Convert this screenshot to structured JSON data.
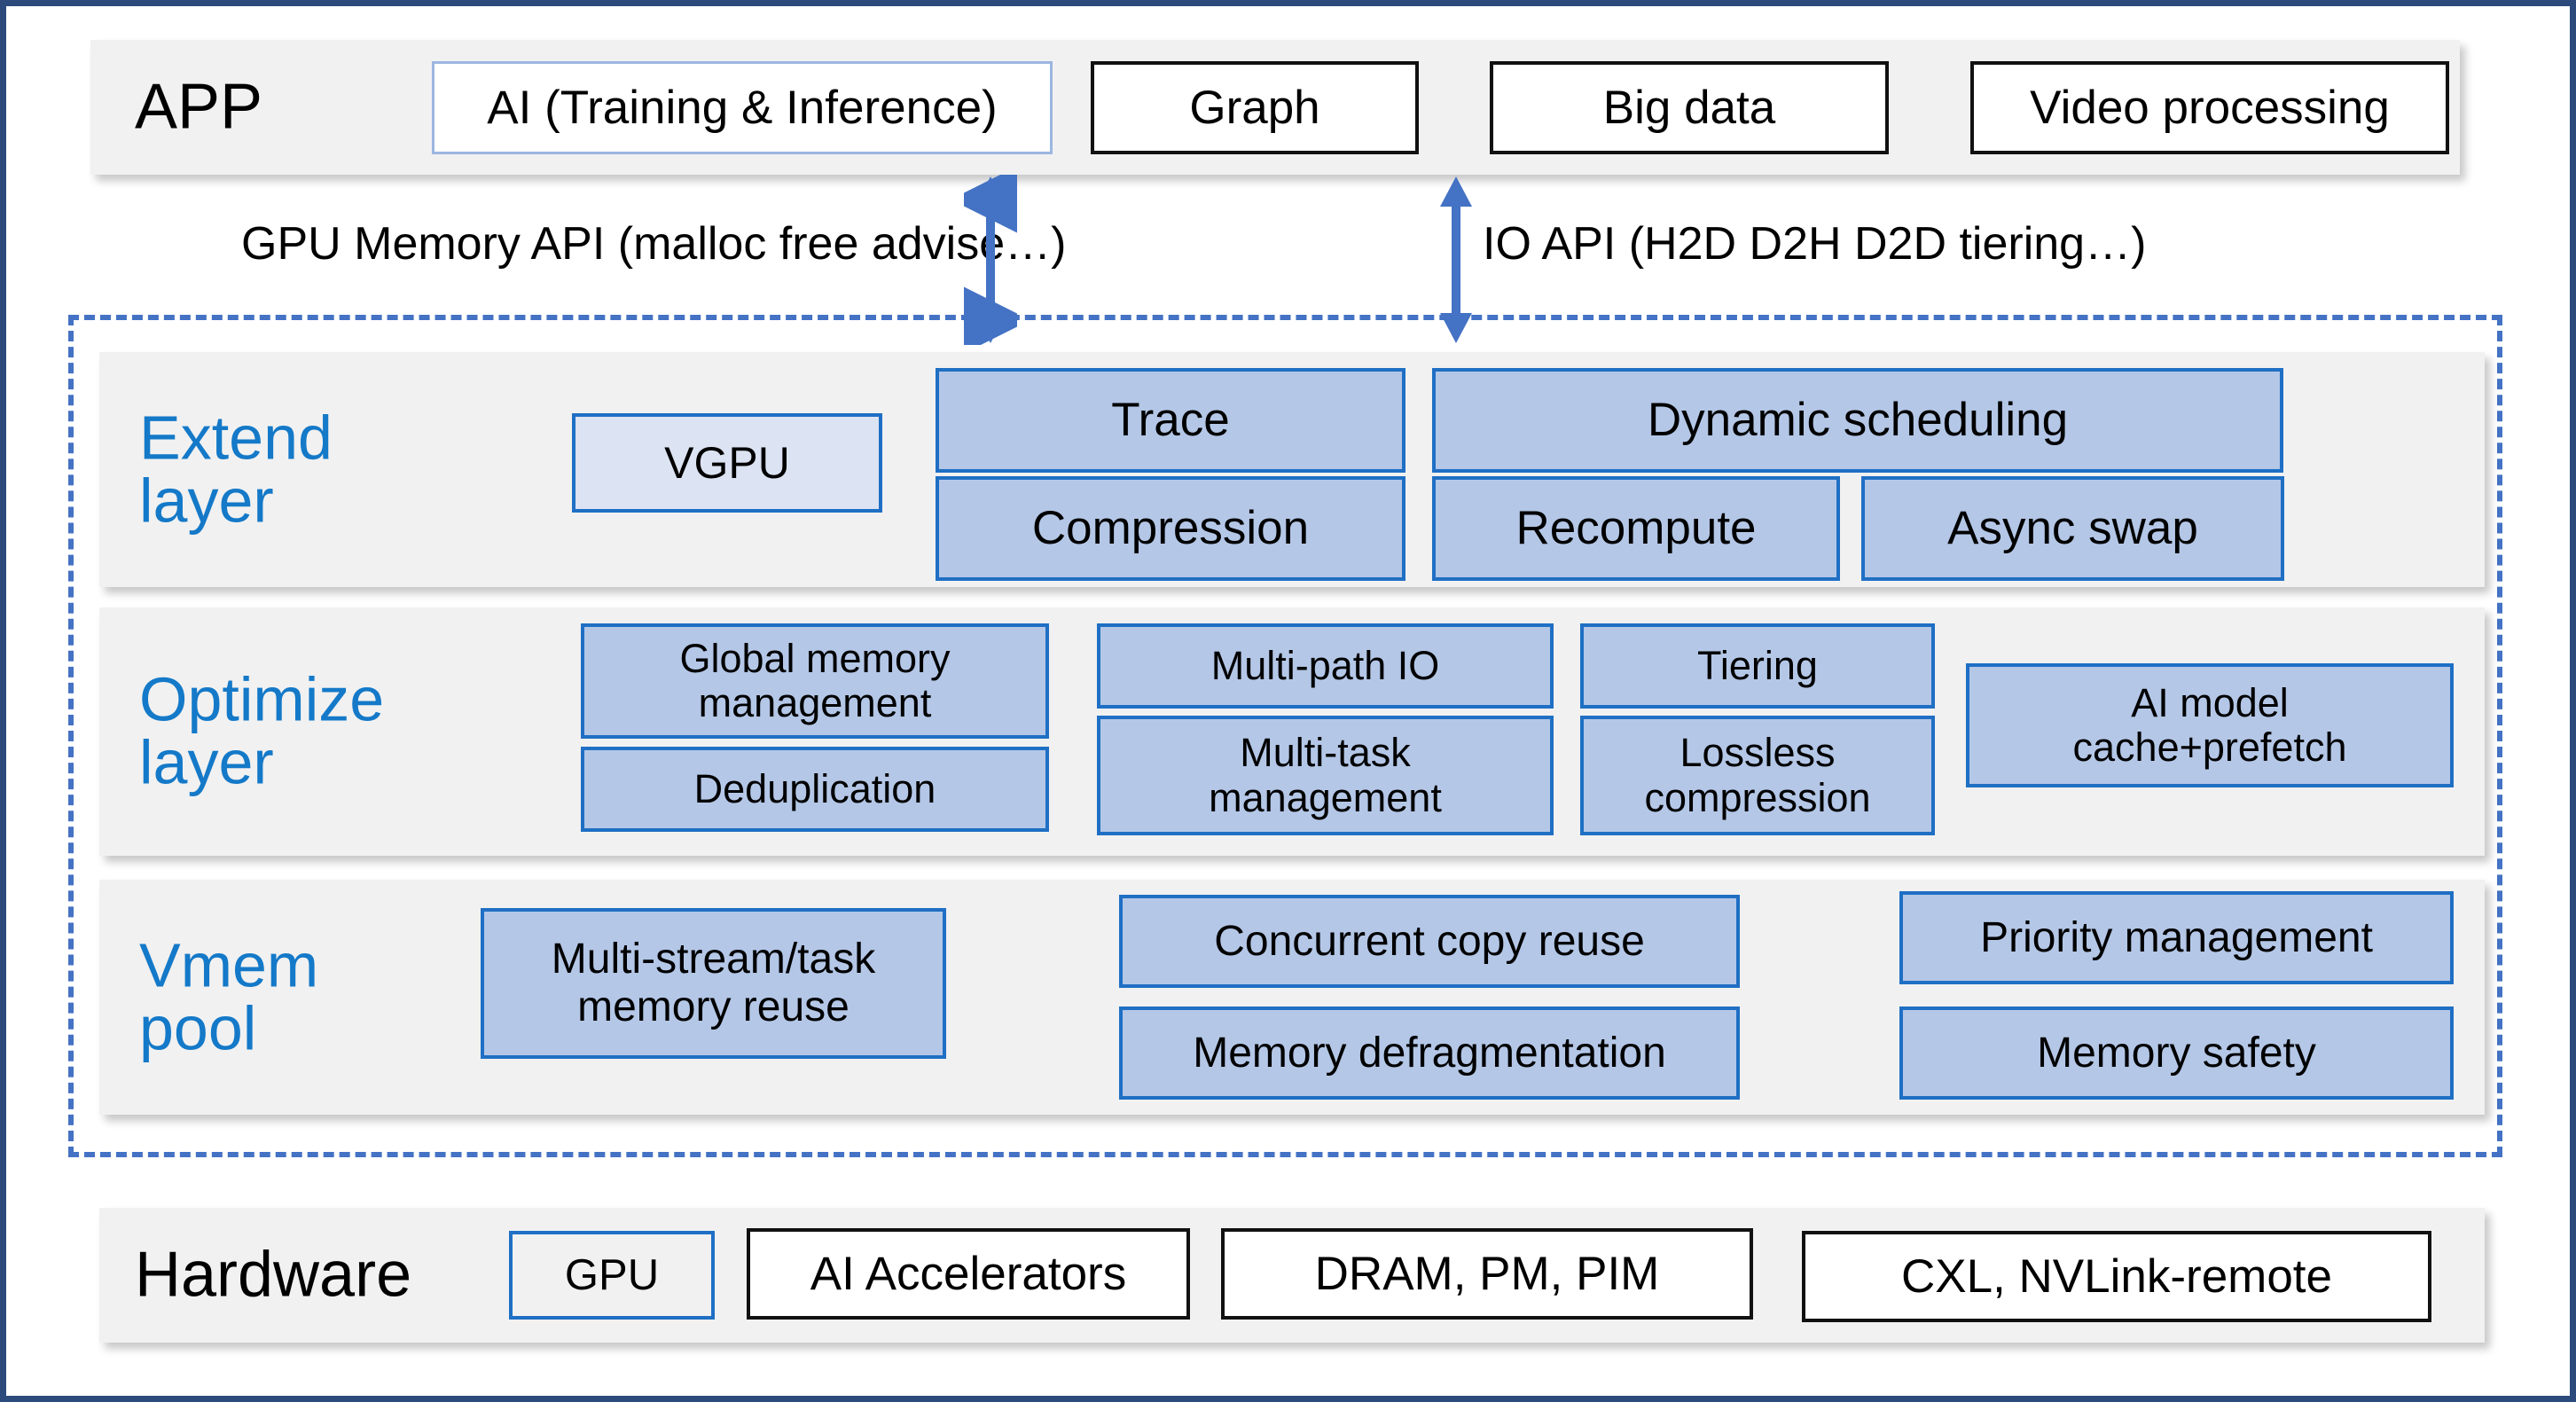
{
  "diagram": {
    "title": "GPU memory framework layered architecture",
    "colors": {
      "frame_border": "#2c4a7c",
      "band_background": "#f1f1f1",
      "dashed_outline": "#4472c4",
      "block_fill": "#b4c7e7",
      "block_fill_light": "#dce3f2",
      "block_border": "#1f6fc4",
      "label_blue": "#1479c8",
      "label_dark": "#000000",
      "arrow": "#4472c4"
    }
  },
  "app_row": {
    "label": "APP",
    "items": [
      {
        "label": "AI (Training & Inference)",
        "style": "white-blue"
      },
      {
        "label": "Graph",
        "style": "white"
      },
      {
        "label": "Big data",
        "style": "white"
      },
      {
        "label": "Video processing",
        "style": "white"
      }
    ]
  },
  "api_labels": {
    "memory_api": "GPU Memory API (malloc free advise…)",
    "io_api": "IO API (H2D D2H D2D tiering…)"
  },
  "arrows": {
    "memory_api_arrow": "double-headed-vertical-arrow",
    "io_api_arrow": "double-headed-vertical-arrow"
  },
  "extend_layer": {
    "label": "Extend\nlayer",
    "items": [
      {
        "label": "VGPU",
        "style": "blue-light"
      },
      {
        "label": "Trace",
        "style": "blue"
      },
      {
        "label": "Dynamic scheduling",
        "style": "blue"
      },
      {
        "label": "Compression",
        "style": "blue"
      },
      {
        "label": "Recompute",
        "style": "blue"
      },
      {
        "label": "Async swap",
        "style": "blue"
      }
    ]
  },
  "optimize_layer": {
    "label": "Optimize\nlayer",
    "items": [
      {
        "label": "Global memory\nmanagement",
        "style": "blue"
      },
      {
        "label": "Multi-path IO",
        "style": "blue"
      },
      {
        "label": "Tiering",
        "style": "blue"
      },
      {
        "label": "AI model\ncache+prefetch",
        "style": "blue"
      },
      {
        "label": "Deduplication",
        "style": "blue"
      },
      {
        "label": "Multi-task\nmanagement",
        "style": "blue"
      },
      {
        "label": "Lossless\ncompression",
        "style": "blue"
      }
    ]
  },
  "vmem_pool_layer": {
    "label": "Vmem\npool",
    "items": [
      {
        "label": "Multi-stream/task\nmemory reuse",
        "style": "blue"
      },
      {
        "label": "Concurrent copy reuse",
        "style": "blue"
      },
      {
        "label": "Priority management",
        "style": "blue"
      },
      {
        "label": "Memory defragmentation",
        "style": "blue"
      },
      {
        "label": "Memory safety",
        "style": "blue"
      }
    ]
  },
  "hardware_row": {
    "label": "Hardware",
    "items": [
      {
        "label": "GPU",
        "style": "ghost-blue"
      },
      {
        "label": "AI Accelerators",
        "style": "white"
      },
      {
        "label": "DRAM, PM, PIM",
        "style": "white"
      },
      {
        "label": "CXL, NVLink-remote",
        "style": "white"
      }
    ]
  }
}
